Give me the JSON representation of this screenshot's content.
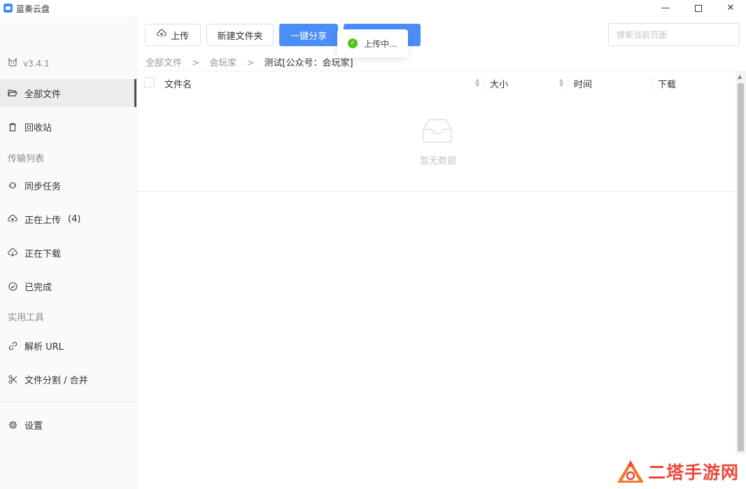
{
  "window": {
    "title": "蓝奏云盘",
    "minimize": "—",
    "close": "✕"
  },
  "sidebar": {
    "version": "v3.4.1",
    "items": [
      {
        "label": "全部文件",
        "icon": "folder-open-icon"
      },
      {
        "label": "回收站",
        "icon": "trash-icon"
      }
    ],
    "transfer_section": "传输列表",
    "transfer_items": [
      {
        "label": "同步任务",
        "icon": "sync-icon"
      },
      {
        "label": "正在上传",
        "count": "(4)",
        "icon": "cloud-upload-icon"
      },
      {
        "label": "正在下载",
        "icon": "cloud-download-icon"
      },
      {
        "label": "已完成",
        "icon": "check-circle-icon"
      }
    ],
    "tools_section": "实用工具",
    "tool_items": [
      {
        "label": "解析 URL",
        "icon": "link-icon"
      },
      {
        "label": "文件分割 / 合并",
        "icon": "scissors-icon"
      }
    ],
    "settings": {
      "label": "设置",
      "icon": "gear-icon"
    }
  },
  "toolbar": {
    "upload": "上传",
    "new_folder": "新建文件夹",
    "share": "一键分享",
    "search_placeholder": "搜索当前页面"
  },
  "toast": {
    "text": "上传中..."
  },
  "breadcrumb": [
    "全部文件",
    "会玩家",
    "测试[公众号：会玩家]"
  ],
  "table": {
    "columns": [
      "文件名",
      "大小",
      "时间",
      "下载"
    ],
    "empty_text": "暂无数据"
  },
  "watermark": {
    "text": "二塔手游网"
  },
  "colors": {
    "primary": "#4b8ef7",
    "success": "#52c41a",
    "watermark": "#e8483a"
  }
}
